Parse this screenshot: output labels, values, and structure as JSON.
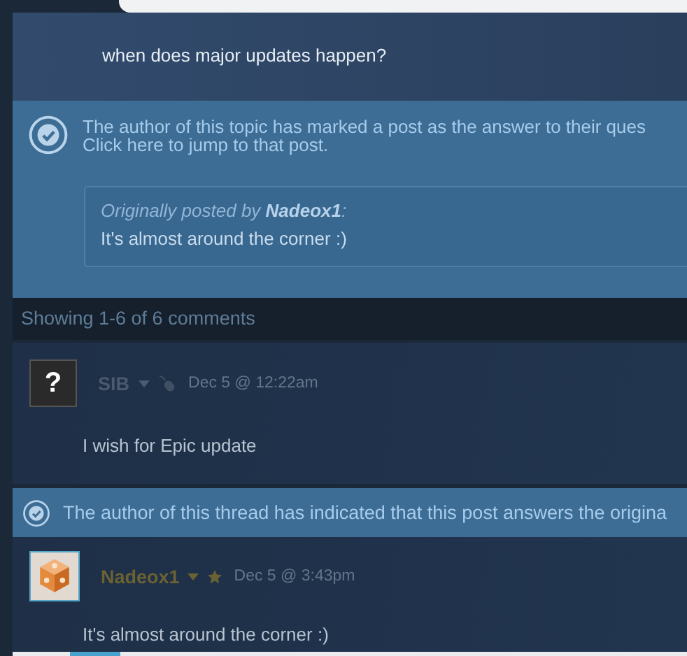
{
  "question": {
    "text": "when does major updates happen?"
  },
  "answer_notice": {
    "lines": [
      "The author of this topic has marked a post as the answer to their ques",
      "Click here to jump to that post."
    ],
    "quote": {
      "prefix": "Originally posted by",
      "author": "Nadeox1",
      "suffix": ":",
      "text": "It's almost around the corner :)"
    }
  },
  "comments_count": "Showing 1-6 of 6 comments",
  "comments": [
    {
      "author": "SIB",
      "avatar": {
        "kind": "glyph",
        "glyph": "?"
      },
      "badge": {
        "kind": "mouse"
      },
      "date": "Dec 5 @ 12:22am",
      "text": "I wish for Epic update",
      "color": "#4a5b6e"
    },
    {
      "author": "Nadeox1",
      "badge": {
        "kind": "star"
      },
      "date": "Dec 5 @ 3:43pm",
      "text": "It's almost around the corner :)",
      "answer_banner": "The author of this thread has indicated that this post answers the origina",
      "color": "#6b6233"
    }
  ]
}
